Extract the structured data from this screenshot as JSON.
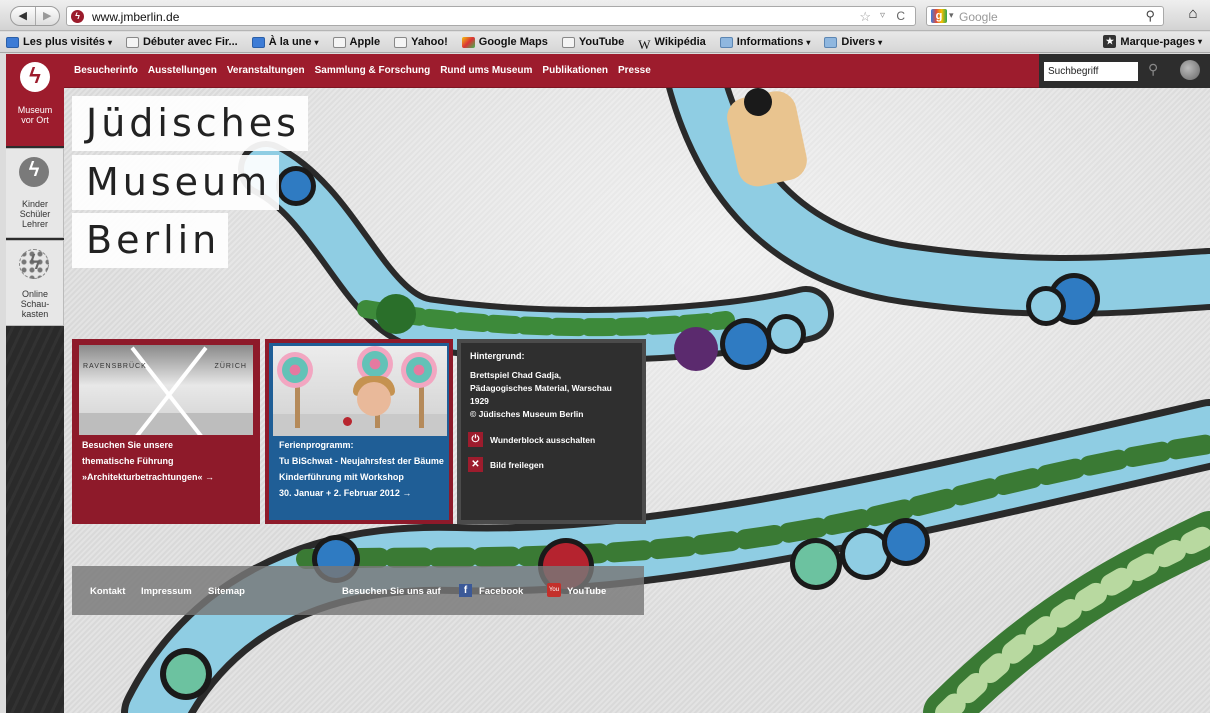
{
  "browser": {
    "url": "www.jmberlin.de",
    "search_engine": "Google",
    "bookmarks": [
      {
        "label": "Les plus visités",
        "icon": "most-visited-icon",
        "dropdown": true
      },
      {
        "label": "Débuter avec Fir...",
        "icon": "page-icon",
        "dropdown": false
      },
      {
        "label": "À la une",
        "icon": "rss-icon",
        "dropdown": true
      },
      {
        "label": "Apple",
        "icon": "page-icon",
        "dropdown": false
      },
      {
        "label": "Yahoo!",
        "icon": "page-icon",
        "dropdown": false
      },
      {
        "label": "Google Maps",
        "icon": "google-maps-icon",
        "dropdown": false
      },
      {
        "label": "YouTube",
        "icon": "page-icon",
        "dropdown": false
      },
      {
        "label": "Wikipédia",
        "icon": "wikipedia-icon",
        "dropdown": false
      },
      {
        "label": "Informations",
        "icon": "folder-icon",
        "dropdown": true
      },
      {
        "label": "Divers",
        "icon": "folder-icon",
        "dropdown": true
      }
    ],
    "bookmarks_menu": "Marque-pages"
  },
  "sidebar": {
    "active": {
      "label_lines": [
        "Museum",
        "vor Ort"
      ]
    },
    "tabs": [
      {
        "label_lines": [
          "Kinder",
          "Schüler",
          "Lehrer"
        ]
      },
      {
        "label_lines": [
          "Online",
          "Schau-",
          "kasten"
        ]
      }
    ]
  },
  "nav": {
    "items": [
      "Besucherinfo",
      "Ausstellungen",
      "Veranstaltungen",
      "Sammlung & Forschung",
      "Rund ums Museum",
      "Publikationen",
      "Presse"
    ],
    "search_placeholder": "Suchbegriff"
  },
  "title": {
    "lines": [
      "Jüdisches",
      "Museum",
      "Berlin"
    ]
  },
  "teasers": [
    {
      "image_words": [
        "RAVENSBRÜCK",
        "ZÜRICH"
      ],
      "lines": [
        "Besuchen Sie unsere",
        "thematische Führung",
        "»Architekturbetrachtungen« →"
      ]
    },
    {
      "lines": [
        "Ferienprogramm:",
        "Tu BiSchwat - Neujahrsfest der Bäume",
        "Kinderführung mit Workshop",
        "30. Januar + 2. Februar 2012 →"
      ]
    }
  ],
  "info_box": {
    "heading": "Hintergrund:",
    "lines": [
      "Brettspiel Chad Gadja,",
      "Pädagogisches Material, Warschau",
      "1929",
      "© Jüdisches Museum Berlin"
    ],
    "actions": [
      {
        "label": "Wunderblock ausschalten",
        "icon": "power-icon"
      },
      {
        "label": "Bild freilegen",
        "icon": "close-icon"
      }
    ]
  },
  "footer": {
    "links": [
      "Kontakt",
      "Impressum",
      "Sitemap"
    ],
    "social_label": "Besuchen Sie uns auf",
    "social": [
      {
        "label": "Facebook",
        "icon": "facebook-icon"
      },
      {
        "label": "YouTube",
        "icon": "youtube-icon"
      }
    ]
  },
  "colors": {
    "brand_red": "#9d1c2d",
    "blue_teaser": "#1f5e96",
    "dark": "#2f2f2f"
  }
}
